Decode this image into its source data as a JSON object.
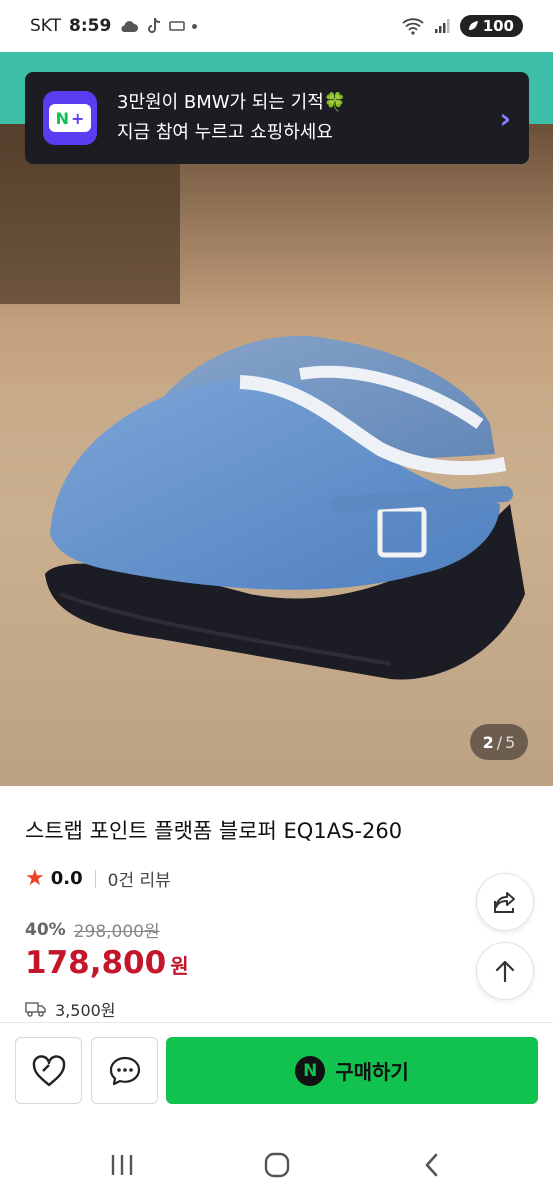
{
  "status_bar": {
    "carrier": "SKT",
    "time": "8:59",
    "battery": "100"
  },
  "banner": {
    "line1": "3만원이 BMW가 되는 기적🍀",
    "line2": "지금 참여 누르고 쇼핑하세요",
    "logo": "N+",
    "arrow": "›"
  },
  "gallery": {
    "current": "2",
    "separator": "/",
    "total": "5"
  },
  "product": {
    "title": "스트랩 포인트 플랫폼 블로퍼 EQ1AS-260",
    "rating": "0.0",
    "review_count": "0건 리뷰",
    "discount_rate": "40%",
    "original_price": "298,000원",
    "price": "178,800",
    "price_unit": "원",
    "shipping_fee": "3,500원"
  },
  "actions": {
    "buy_label": "구매하기",
    "npay_mark": "N"
  },
  "icons": {
    "share": "share-icon",
    "scroll_top": "arrow-up-icon",
    "like": "heart-icon",
    "chat": "chat-icon",
    "truck": "truck-icon"
  },
  "colors": {
    "accent_green": "#12c24f",
    "price_red": "#c4162b",
    "star": "#f04124",
    "banner_bg": "#1c1d22",
    "teal_header": "#3dbfa7"
  }
}
